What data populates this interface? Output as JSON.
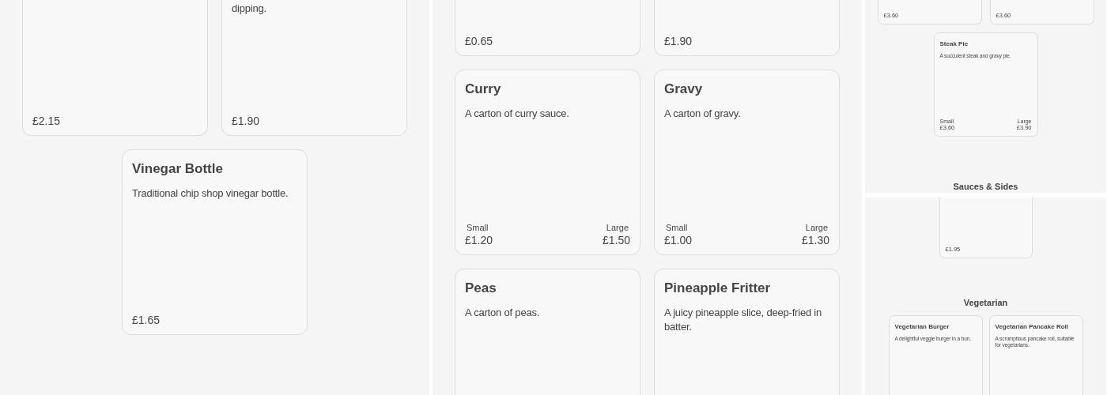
{
  "panels": [
    {
      "sections": [
        {
          "cards": [
            {
              "cut_off_top": true,
              "prices": [
                {
                  "price": "£2.15"
                }
              ]
            },
            {
              "cut_off_top": true,
              "description": "dipping.",
              "prices": [
                {
                  "price": "£1.90"
                }
              ]
            },
            {
              "cut_off_top": false,
              "title": "Vinegar Bottle",
              "description": "Traditional chip shop vinegar bottle.",
              "prices": [
                {
                  "price": "£1.65"
                }
              ]
            }
          ]
        }
      ]
    },
    {
      "sections": [
        {
          "cards": [
            {
              "cut_off_top": true,
              "prices": [
                {
                  "price": "£0.65"
                }
              ]
            },
            {
              "cut_off_top": true,
              "prices": [
                {
                  "price": "£1.90"
                }
              ]
            },
            {
              "cut_off_top": false,
              "title": "Curry",
              "description": "A carton of curry sauce.",
              "prices": [
                {
                  "size": "Small",
                  "price": "£1.20"
                },
                {
                  "size": "Large",
                  "price": "£1.50"
                }
              ]
            },
            {
              "cut_off_top": false,
              "title": "Gravy",
              "description": "A carton of gravy.",
              "prices": [
                {
                  "size": "Small",
                  "price": "£1.00"
                },
                {
                  "size": "Large",
                  "price": "£1.30"
                }
              ]
            },
            {
              "cut_off_top": false,
              "title": "Peas",
              "description": "A carton of peas."
            },
            {
              "cut_off_top": false,
              "title": "Pineapple Fritter",
              "description": "A juicy pineapple slice, deep-fried in batter."
            }
          ]
        }
      ]
    },
    {
      "sections": [
        {
          "cards": [
            {
              "cut_off_top": true,
              "prices": [
                {
                  "price": "£3.60"
                }
              ]
            },
            {
              "cut_off_top": true,
              "prices": [
                {
                  "price": "£3.60"
                }
              ]
            },
            {
              "cut_off_top": false,
              "title": "Steak Pie",
              "description": "A succulent steak and gravy pie.",
              "prices": [
                {
                  "size": "Small",
                  "price": "£3.60"
                },
                {
                  "size": "Large",
                  "price": "£3.90"
                }
              ]
            }
          ]
        },
        {
          "heading": "Sauces & Sides",
          "pinned": true,
          "cards": [
            {
              "cut_off_top": true,
              "prices": [
                {
                  "price": "£1.95"
                }
              ]
            }
          ]
        },
        {
          "heading": "Vegetarian",
          "pinned": false,
          "cards": [
            {
              "cut_off_top": false,
              "title": "Vegetarian Burger",
              "description": "A delightful veggie burger in a bun."
            },
            {
              "cut_off_top": false,
              "title": "Vegetarian Pancake Roll",
              "description": "A scrumptious pancake roll, suitable for vegetarians."
            }
          ]
        }
      ]
    }
  ]
}
